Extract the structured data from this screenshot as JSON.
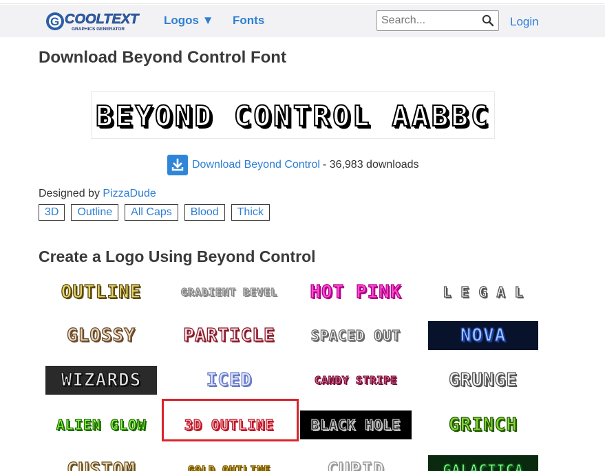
{
  "header": {
    "logo_text": "COOLTEXT",
    "logo_subtext": "GRAPHICS GENERATOR",
    "nav": [
      {
        "label": "Logos ▼"
      },
      {
        "label": "Fonts"
      }
    ],
    "search_placeholder": "Search...",
    "login_label": "Login"
  },
  "page": {
    "title": "Download Beyond Control Font",
    "preview_text": "BEYOND CONTROL AABBC",
    "download_link": "Download Beyond Control",
    "download_count": "- 36,983 downloads",
    "designed_by_label": "Designed by",
    "designer": "PizzaDude",
    "tags": [
      "3D",
      "Outline",
      "All Caps",
      "Blood",
      "Thick"
    ]
  },
  "logos_section": {
    "title": "Create a Logo Using Beyond Control",
    "items": [
      {
        "label": "OUTLINE",
        "color": "#e8d36a",
        "stroke": "#5a4a10",
        "bg": "transparent"
      },
      {
        "label": "GRADIENT BEVEL",
        "color": "#f2f2f2",
        "stroke": "#8a8a8a",
        "bg": "transparent"
      },
      {
        "label": "HOT PINK",
        "color": "#ff4fd0",
        "stroke": "#b0008a",
        "bg": "transparent"
      },
      {
        "label": "L E G A L",
        "color": "#ffffff",
        "stroke": "#555555",
        "bg": "transparent"
      },
      {
        "label": "GLOSSY",
        "color": "#e7d7c1",
        "stroke": "#6b4a2a",
        "bg": "transparent"
      },
      {
        "label": "PARTICLE",
        "color": "#f4e6ea",
        "stroke": "#8a1a2a",
        "bg": "transparent"
      },
      {
        "label": "SPACED OUT",
        "color": "#f6f6f6",
        "stroke": "#6a6a6a",
        "bg": "transparent"
      },
      {
        "label": "NOVA",
        "color": "#9ec4ff",
        "stroke": "#1b3f9e",
        "bg": "#08122b"
      },
      {
        "label": "WIZARDS",
        "color": "#e6e6e6",
        "stroke": "#111111",
        "bg": "#2a2a2a"
      },
      {
        "label": "ICED",
        "color": "#dde6ff",
        "stroke": "#6a7bc4",
        "bg": "transparent"
      },
      {
        "label": "CANDY STRIPE",
        "color": "#ff9fbf",
        "stroke": "#7a1038",
        "bg": "transparent"
      },
      {
        "label": "GRUNGE",
        "color": "#f5f5f5",
        "stroke": "#555555",
        "bg": "transparent"
      },
      {
        "label": "ALIEN GLOW",
        "color": "#8cff4a",
        "stroke": "#1f6b00",
        "bg": "transparent"
      },
      {
        "label": "3D OUTLINE",
        "color": "#f3c3c8",
        "stroke": "#c01828",
        "bg": "transparent"
      },
      {
        "label": "BLACK HOLE",
        "color": "#202020",
        "stroke": "#bdbdbd",
        "bg": "#000000"
      },
      {
        "label": "GRINCH",
        "color": "#8ad43a",
        "stroke": "#1f5a00",
        "bg": "transparent"
      },
      {
        "label": "CUSTOM",
        "color": "#f0e0c0",
        "stroke": "#6a5020",
        "bg": "transparent"
      },
      {
        "label": "GOLD OUTLINE",
        "color": "#f5d35a",
        "stroke": "#7a5a00",
        "bg": "transparent"
      },
      {
        "label": "CUPID",
        "color": "#f5f5f5",
        "stroke": "#9a9a9a",
        "bg": "transparent"
      },
      {
        "label": "GALACTICA",
        "color": "#8fff8f",
        "stroke": "#0a5a1a",
        "bg": "#0a2a10"
      }
    ]
  }
}
